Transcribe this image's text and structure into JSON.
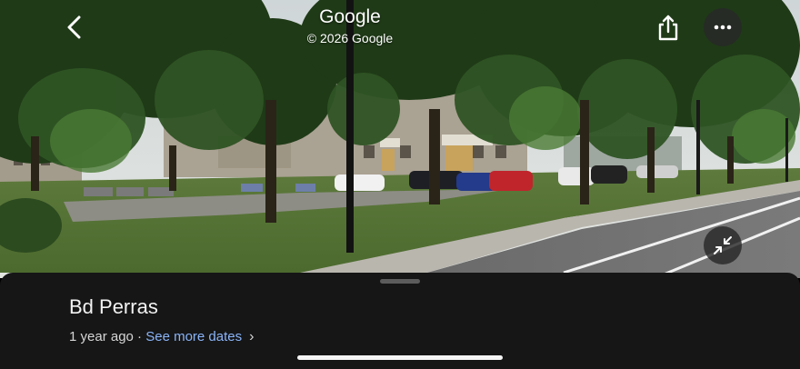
{
  "header": {
    "title": "Google",
    "copyright": "© 2026 Google"
  },
  "icons": {
    "back": "chevron-left-icon",
    "share": "share-icon",
    "more": "more-horizontal-icon",
    "collapse": "collapse-arrows-icon"
  },
  "sheet": {
    "place_name": "Bd Perras",
    "age": "1 year ago",
    "separator": " · ",
    "see_more": "See more dates",
    "chevron": "›"
  },
  "colors": {
    "sheet_bg": "#161616",
    "link": "#8ab4f8",
    "button_bg": "#282828"
  }
}
